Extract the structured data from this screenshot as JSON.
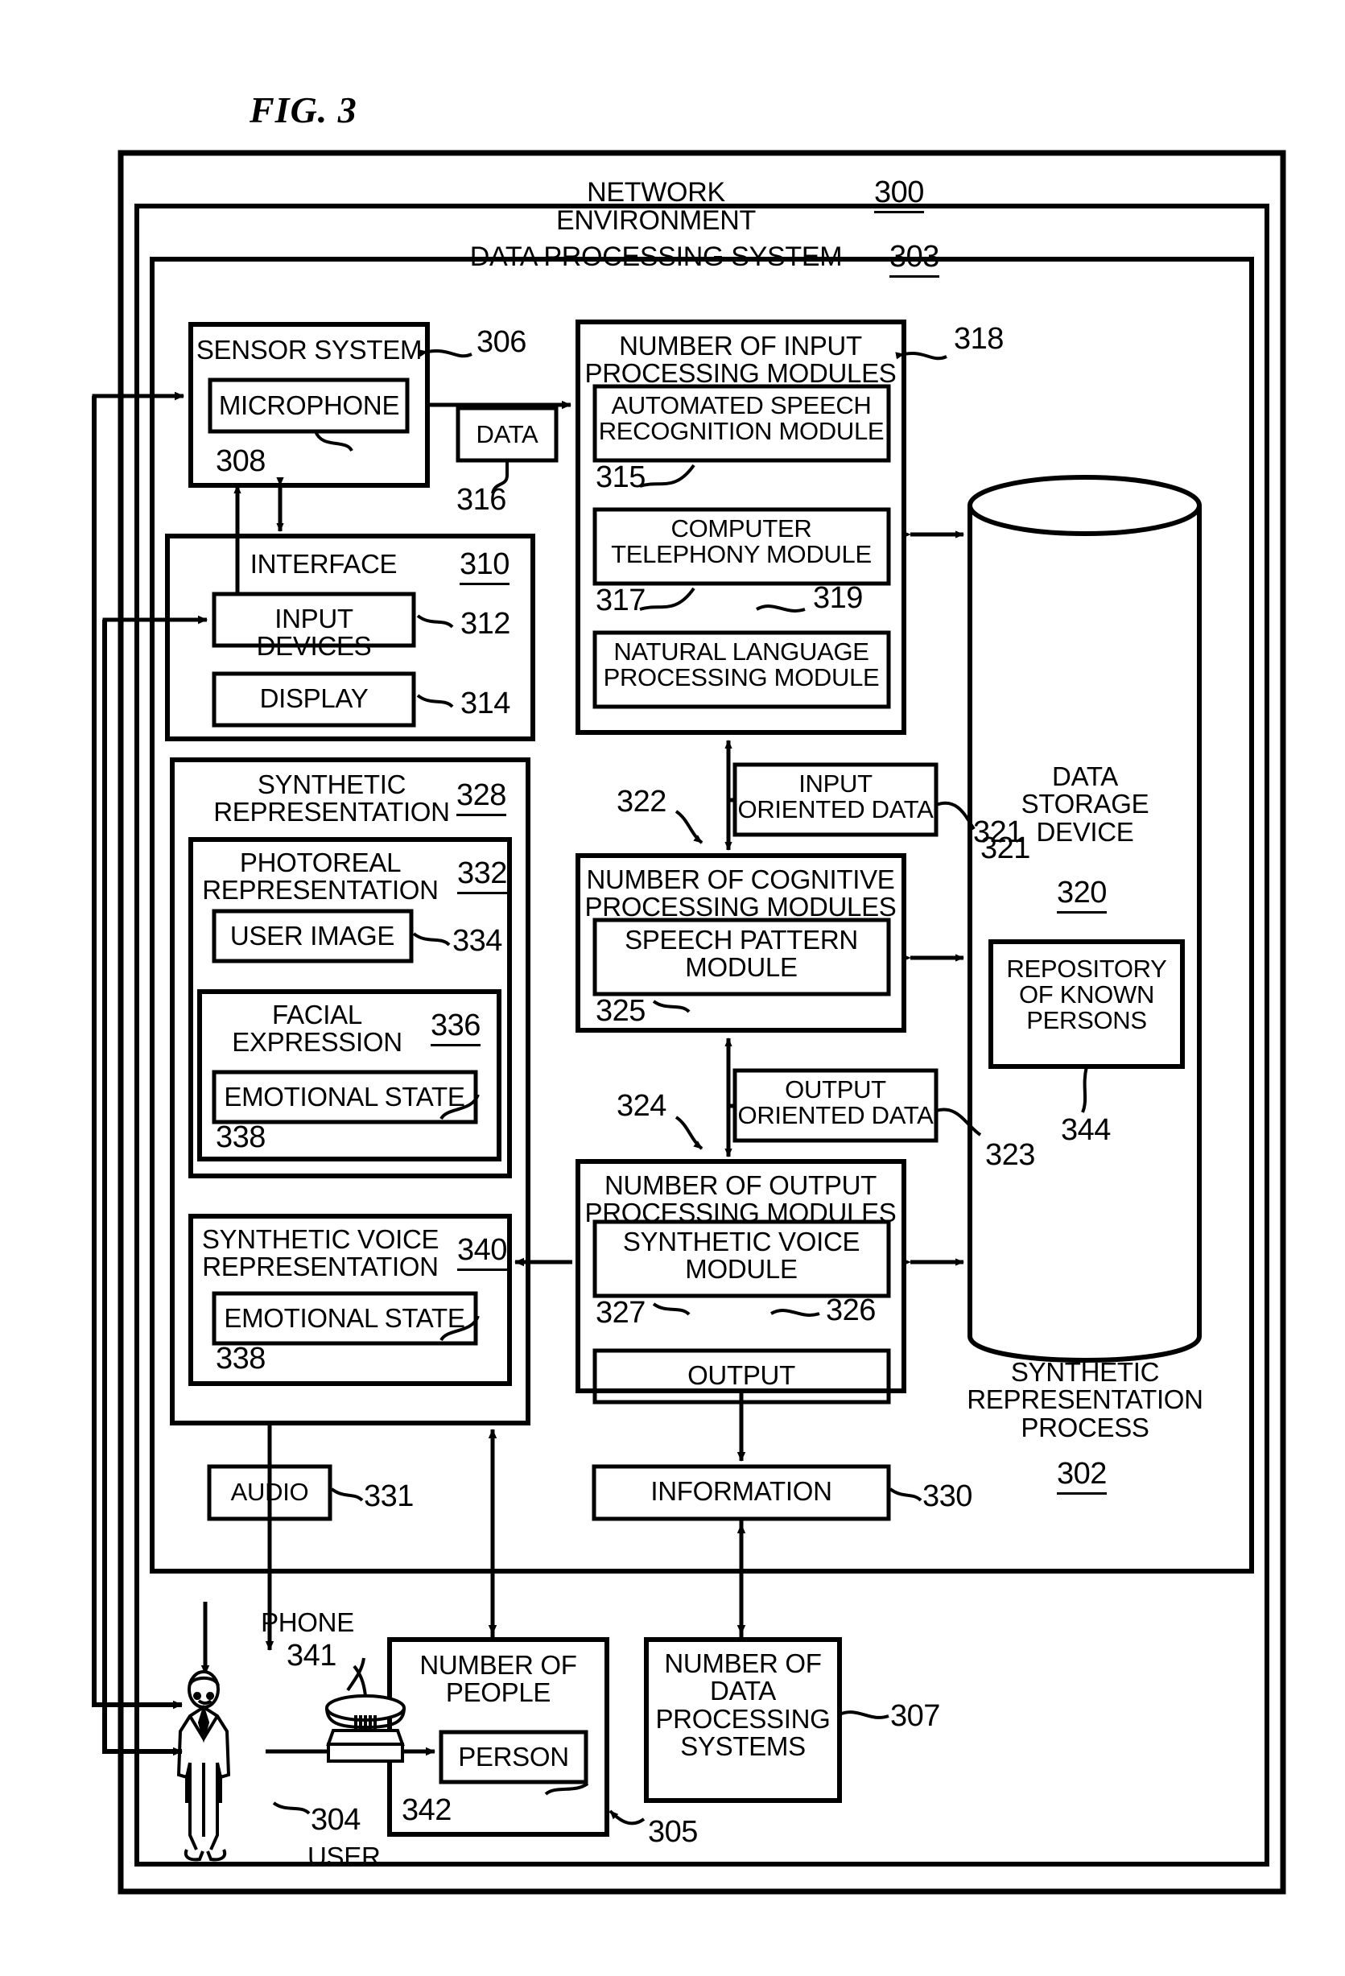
{
  "figure": {
    "label": "FIG. 3"
  },
  "containers": {
    "network_environment": {
      "title": "NETWORK ENVIRONMENT",
      "ref": "300"
    },
    "data_processing_system": {
      "title": "DATA PROCESSING SYSTEM",
      "ref": "303"
    },
    "synthetic_representation_process": {
      "title": "SYNTHETIC\nREPRESENTATION\nPROCESS",
      "ref": "302"
    }
  },
  "blocks": {
    "sensor_system": {
      "title": "SENSOR SYSTEM",
      "ref": "306"
    },
    "microphone": {
      "title": "MICROPHONE",
      "ref": "308"
    },
    "data": {
      "title": "DATA",
      "ref": "316"
    },
    "input_modules": {
      "title": "NUMBER OF INPUT\nPROCESSING MODULES",
      "ref": "318"
    },
    "asr_module": {
      "title": "AUTOMATED SPEECH\nRECOGNITION MODULE",
      "ref": "315"
    },
    "telephony_module": {
      "title": "COMPUTER\nTELEPHONY MODULE",
      "ref": "317"
    },
    "nlp_module": {
      "title": "NATURAL LANGUAGE\nPROCESSING MODULE",
      "ref": "319"
    },
    "interface": {
      "title": "INTERFACE",
      "ref": "310"
    },
    "input_devices": {
      "title": "INPUT DEVICES",
      "ref": "312"
    },
    "display": {
      "title": "DISPLAY",
      "ref": "314"
    },
    "synthetic_representation": {
      "title": "SYNTHETIC\nREPRESENTATION",
      "ref": "328"
    },
    "photoreal_representation": {
      "title": "PHOTOREAL\nREPRESENTATION",
      "ref": "332"
    },
    "user_image": {
      "title": "USER IMAGE",
      "ref": "334"
    },
    "facial_expression": {
      "title": "FACIAL\nEXPRESSION",
      "ref": "336"
    },
    "emotional_state_facial": {
      "title": "EMOTIONAL STATE",
      "ref": "338"
    },
    "synthetic_voice_representation": {
      "title": "SYNTHETIC VOICE\nREPRESENTATION",
      "ref": "340"
    },
    "emotional_state_voice": {
      "title": "EMOTIONAL STATE",
      "ref": "338"
    },
    "input_oriented_data": {
      "title": "INPUT\nORIENTED DATA",
      "ref": "321"
    },
    "cognitive_modules": {
      "title": "NUMBER OF COGNITIVE\nPROCESSING MODULES",
      "ref": "322"
    },
    "speech_pattern_module": {
      "title": "SPEECH PATTERN\nMODULE",
      "ref": "325"
    },
    "output_oriented_data": {
      "title": "OUTPUT\nORIENTED DATA",
      "ref": "323"
    },
    "output_modules": {
      "title": "NUMBER OF OUTPUT\nPROCESSING MODULES",
      "ref": "324"
    },
    "synthetic_voice_module": {
      "title": "SYNTHETIC VOICE\nMODULE",
      "ref": "327"
    },
    "output": {
      "title": "OUTPUT",
      "ref": "326"
    },
    "data_storage_device": {
      "title": "DATA\nSTORAGE\nDEVICE",
      "ref": "320"
    },
    "repository_known_persons": {
      "title": "REPOSITORY\nOF KNOWN\nPERSONS",
      "ref": "344"
    },
    "audio": {
      "title": "AUDIO",
      "ref": "331"
    },
    "information": {
      "title": "INFORMATION",
      "ref": "330"
    },
    "user": {
      "title": "USER",
      "ref": "304"
    },
    "phone": {
      "title": "PHONE",
      "ref": "341"
    },
    "number_of_people": {
      "title": "NUMBER OF\nPEOPLE",
      "ref": "305"
    },
    "person": {
      "title": "PERSON",
      "ref": "342"
    },
    "number_of_data_processing_systems": {
      "title": "NUMBER OF\nDATA\nPROCESSING\nSYSTEMS",
      "ref": "307"
    }
  }
}
